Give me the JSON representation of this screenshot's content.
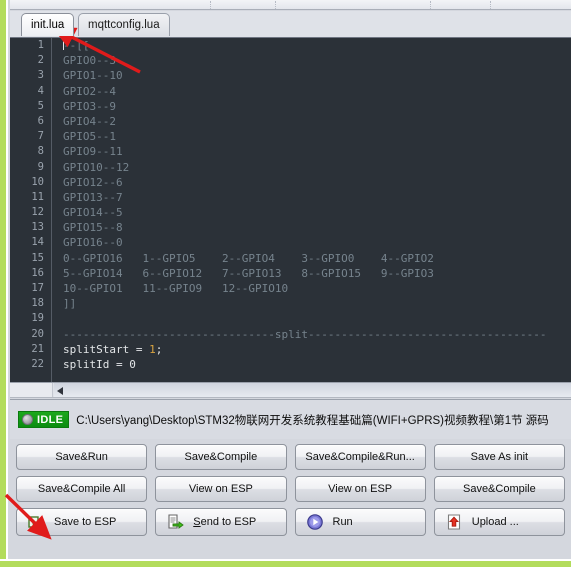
{
  "window": {
    "accent_green": "#b3dc5c",
    "editor_bg": "#2b3138",
    "status_green": "#14980f",
    "annotation_color": "#e01b1b"
  },
  "tabs": [
    {
      "label": "init.lua",
      "active": true
    },
    {
      "label": "mqttconfig.lua",
      "active": false
    }
  ],
  "editor": {
    "line_numbers": [
      "1",
      "2",
      "3",
      "4",
      "5",
      "6",
      "7",
      "8",
      "9",
      "10",
      "11",
      "12",
      "13",
      "14",
      "15",
      "16",
      "17",
      "18",
      "19",
      "20",
      "21",
      "22"
    ],
    "lines": [
      {
        "n": 1,
        "text": "--[[",
        "kind": "comment",
        "caret": true
      },
      {
        "n": 2,
        "text": "GPIO0--3",
        "kind": "comment"
      },
      {
        "n": 3,
        "text": "GPIO1--10",
        "kind": "comment"
      },
      {
        "n": 4,
        "text": "GPIO2--4",
        "kind": "comment"
      },
      {
        "n": 5,
        "text": "GPIO3--9",
        "kind": "comment"
      },
      {
        "n": 6,
        "text": "GPIO4--2",
        "kind": "comment"
      },
      {
        "n": 7,
        "text": "GPIO5--1",
        "kind": "comment"
      },
      {
        "n": 8,
        "text": "GPIO9--11",
        "kind": "comment"
      },
      {
        "n": 9,
        "text": "GPIO10--12",
        "kind": "comment"
      },
      {
        "n": 10,
        "text": "GPIO12--6",
        "kind": "comment"
      },
      {
        "n": 11,
        "text": "GPIO13--7",
        "kind": "comment"
      },
      {
        "n": 12,
        "text": "GPIO14--5",
        "kind": "comment"
      },
      {
        "n": 13,
        "text": "GPIO15--8",
        "kind": "comment"
      },
      {
        "n": 14,
        "text": "GPIO16--0",
        "kind": "comment"
      },
      {
        "n": 15,
        "text": "0--GPIO16   1--GPIO5    2--GPIO4    3--GPIO0    4--GPIO2",
        "kind": "comment"
      },
      {
        "n": 16,
        "text": "5--GPIO14   6--GPIO12   7--GPIO13   8--GPIO15   9--GPIO3",
        "kind": "comment"
      },
      {
        "n": 17,
        "text": "10--GPIO1   11--GPIO9   12--GPIO10",
        "kind": "comment"
      },
      {
        "n": 18,
        "text": "]]",
        "kind": "comment"
      },
      {
        "n": 19,
        "text": "",
        "kind": "comment"
      },
      {
        "n": 20,
        "text": "--------------------------------split------------------------------------",
        "kind": "comment"
      },
      {
        "n": 21,
        "text": "splitStart = ",
        "kind": "code",
        "number_token": "1",
        "tail": ";"
      },
      {
        "n": 22,
        "text": "splitId = 0",
        "kind": "code"
      }
    ]
  },
  "scrollbar": {
    "left_arrow_icon": "triangle-left-icon"
  },
  "status": {
    "badge_label": "IDLE",
    "badge_icon": "status-circle-icon",
    "path": "C:\\Users\\yang\\Desktop\\STM32物联网开发系统教程基础篇(WIFI+GPRS)视频教程\\第1节 源码"
  },
  "buttons": {
    "row1": [
      {
        "label": "Save&Run"
      },
      {
        "label": "Save&Compile"
      },
      {
        "label": "Save&Compile&Run..."
      },
      {
        "label": "Save As init"
      }
    ],
    "row2": [
      {
        "label": "Save&Compile All"
      },
      {
        "label": "View on ESP"
      },
      {
        "label": "View on ESP"
      },
      {
        "label": "Save&Compile"
      }
    ],
    "row3": [
      {
        "label": "Save to ESP",
        "icon": "save-to-esp-icon"
      },
      {
        "label_pre": "S",
        "label": "end to ESP",
        "icon": "send-to-esp-icon"
      },
      {
        "label": "Run",
        "icon": "run-play-icon"
      },
      {
        "label": "Upload ...",
        "icon": "upload-icon"
      }
    ]
  },
  "annotations": [
    {
      "name": "arrow-pointing-to-init-tab",
      "target": "init.lua tab"
    },
    {
      "name": "arrow-pointing-to-save-to-esp",
      "target": "Save to ESP button"
    }
  ]
}
